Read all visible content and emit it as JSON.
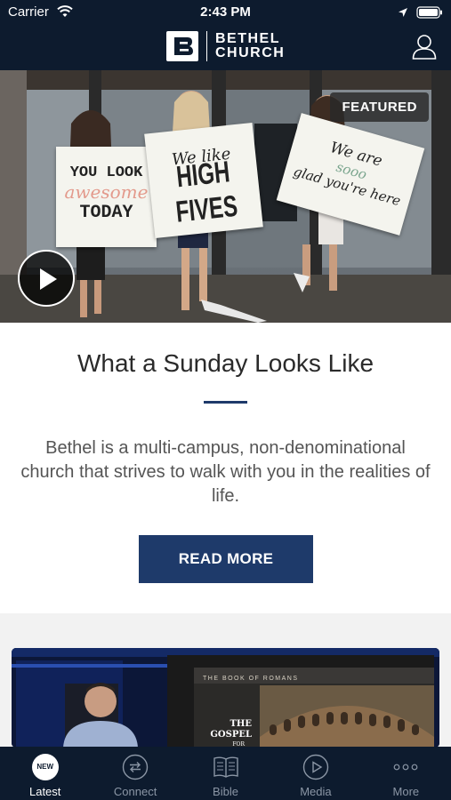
{
  "status_bar": {
    "carrier": "Carrier",
    "time": "2:43 PM"
  },
  "header": {
    "logo_line1": "BETHEL",
    "logo_line2": "CHURCH"
  },
  "hero": {
    "badge": "FEATURED",
    "sign1": [
      "YOU LOOK",
      "awesome",
      "TODAY"
    ],
    "sign2": [
      "We like",
      "HIGH FIVES"
    ],
    "sign3": [
      "We are",
      "sooo",
      "glad you're here"
    ]
  },
  "feature_card": {
    "title": "What a Sunday Looks Like",
    "body": "Bethel is a multi-campus, non-denominational church that strives to walk with you in the realities of life.",
    "button_label": "READ MORE"
  },
  "media_card": {
    "slide_top": "THE BOOK OF ROMANS",
    "slide_title_1": "THE",
    "slide_title_2": "GOSPEL",
    "slide_title_3": "FOR"
  },
  "tabs": [
    {
      "label": "Latest",
      "icon": "new-badge-icon",
      "badge": "NEW",
      "active": true
    },
    {
      "label": "Connect",
      "icon": "connect-arrows-icon",
      "active": false
    },
    {
      "label": "Bible",
      "icon": "bible-book-icon",
      "active": false
    },
    {
      "label": "Media",
      "icon": "play-circle-icon",
      "active": false
    },
    {
      "label": "More",
      "icon": "more-dots-icon",
      "active": false
    }
  ],
  "colors": {
    "navy": "#0d1b2e",
    "accent": "#1e3a6a"
  }
}
